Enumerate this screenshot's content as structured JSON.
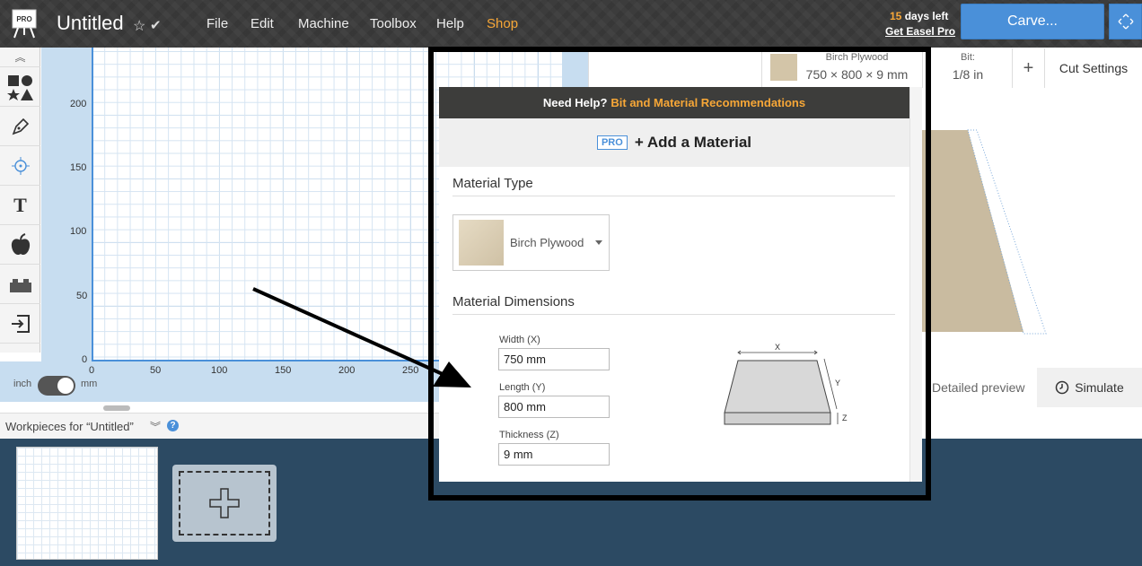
{
  "app": {
    "badge": "PRO",
    "title": "Untitled"
  },
  "menu": [
    "File",
    "Edit",
    "Machine",
    "Toolbox",
    "Help",
    "Shop"
  ],
  "trial": {
    "days": "15",
    "days_suffix": " days left",
    "cta": "Get Easel Pro"
  },
  "carve_label": "Carve...",
  "canvas": {
    "y_ticks": [
      "200",
      "150",
      "100",
      "50",
      "0"
    ],
    "x_ticks": [
      "0",
      "50",
      "100",
      "150",
      "200",
      "250"
    ],
    "unit_left": "inch",
    "unit_right": "mm"
  },
  "material_summary": {
    "name": "Birch Plywood",
    "dims": "750 × 800 × 9 mm"
  },
  "bit": {
    "label": "Bit:",
    "value": "1/8 in"
  },
  "plus_label": "+",
  "cut_settings_label": "Cut Settings",
  "preview": {
    "detailed_label": "Detailed preview",
    "simulate_label": "Simulate"
  },
  "workpieces": {
    "header": "Workpieces for “Untitled”",
    "help": "?"
  },
  "modal": {
    "help_prefix": "Need Help?",
    "help_link": "Bit and Material Recommendations",
    "pro_badge": "PRO",
    "add_material": "+ Add a Material",
    "material_type_heading": "Material Type",
    "material_type_value": "Birch Plywood",
    "dimensions_heading": "Material Dimensions",
    "width_label": "Width (X)",
    "width_value": "750 mm",
    "length_label": "Length (Y)",
    "length_value": "800 mm",
    "thickness_label": "Thickness (Z)",
    "thickness_value": "9 mm",
    "diagram": {
      "x": "X",
      "y": "Y",
      "z": "Z"
    }
  },
  "colors": {
    "accent": "#4a90d9",
    "shop": "#f7a737",
    "workpiece_bg": "#2c4a63"
  }
}
